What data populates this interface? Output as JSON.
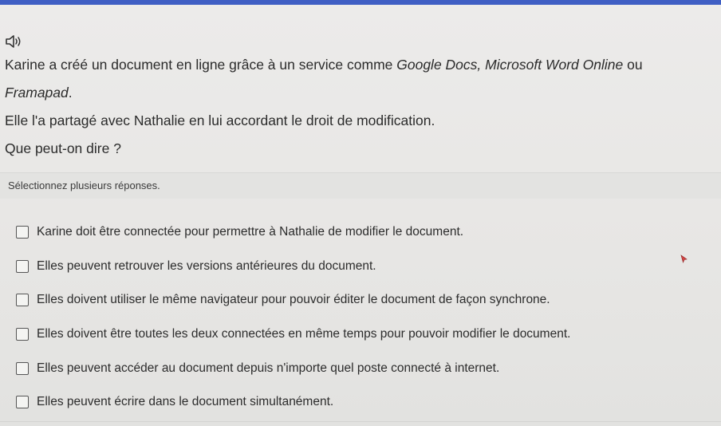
{
  "question": {
    "line1_a": "Karine a créé un document en ligne grâce à un service comme ",
    "line1_em": "Google Docs, Microsoft Word Online",
    "line1_b": " ou",
    "line2_em": "Framapad",
    "line2_b": ".",
    "line3": "Elle l'a partagé avec Nathalie en lui accordant le droit de modification.",
    "line4": "Que peut-on dire ?"
  },
  "instructions": "Sélectionnez plusieurs réponses.",
  "options": [
    {
      "label": "Karine doit être connectée pour permettre à Nathalie de modifier le document.",
      "checked": false
    },
    {
      "label": "Elles peuvent retrouver les versions antérieures du document.",
      "checked": false
    },
    {
      "label": "Elles doivent utiliser le même navigateur pour pouvoir éditer le document de façon synchrone.",
      "checked": false
    },
    {
      "label": "Elles doivent être toutes les deux connectées en même temps pour pouvoir modifier le document.",
      "checked": false
    },
    {
      "label": "Elles peuvent accéder au document depuis n'importe quel poste connecté à internet.",
      "checked": false
    },
    {
      "label": "Elles peuvent écrire dans le document simultanément.",
      "checked": false
    }
  ],
  "icons": {
    "audio": "speaker-icon"
  },
  "colors": {
    "top_bar": "#3f5fc4"
  }
}
